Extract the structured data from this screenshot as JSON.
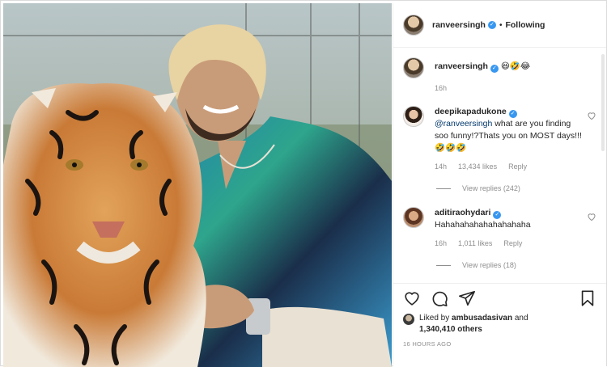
{
  "post": {
    "author": "ranveersingh",
    "follow_label": "Following",
    "separator": "•"
  },
  "caption": {
    "username": "ranveersingh",
    "text": "😆🤣😂",
    "time": "16h"
  },
  "comments": [
    {
      "username": "deepikapadukone",
      "mention": "@ranveersingh",
      "text": " what are you finding soo funny!?Thats you on MOST days!!!🤣🤣🤣",
      "time": "14h",
      "likes": "13,434 likes",
      "reply_label": "Reply",
      "view_replies": "View replies (242)"
    },
    {
      "username": "aditiraohydari",
      "mention": "",
      "text": "Hahahahahahahahahaha",
      "time": "16h",
      "likes": "1,011 likes",
      "reply_label": "Reply",
      "view_replies": "View replies (18)"
    }
  ],
  "likes": {
    "prefix": "Liked by ",
    "user": "ambusadasivan",
    "middle": " and",
    "count": "1,340,410 others"
  },
  "timestamp": "16 HOURS AGO",
  "icons": {
    "like": "heart-icon",
    "comment": "comment-icon",
    "share": "paper-plane-icon",
    "save": "bookmark-icon",
    "verified": "verified-badge-icon"
  },
  "colors": {
    "verified": "#3897f0",
    "link": "#00376b",
    "muted": "#8e8e8e"
  }
}
